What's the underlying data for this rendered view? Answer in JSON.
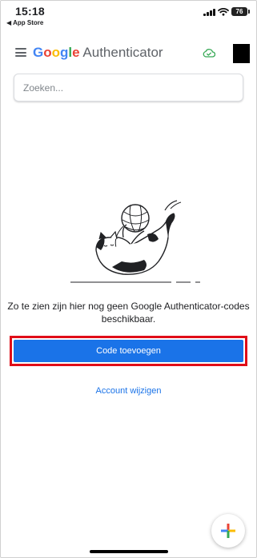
{
  "status_bar": {
    "time": "15:18",
    "back_label": "◀ App Store",
    "battery_level": "76"
  },
  "app_bar": {
    "brand_letters": [
      {
        "char": "G",
        "color": "#4285F4"
      },
      {
        "char": "o",
        "color": "#EA4335"
      },
      {
        "char": "o",
        "color": "#FBBC05"
      },
      {
        "char": "g",
        "color": "#4285F4"
      },
      {
        "char": "l",
        "color": "#34A853"
      },
      {
        "char": "e",
        "color": "#EA4335"
      }
    ],
    "product_name": " Authenticator",
    "menu_icon": "hamburger-menu-icon",
    "sync_icon": "cloud-check-icon"
  },
  "search": {
    "placeholder": "Zoeken..."
  },
  "empty_state": {
    "illustration_icon": "cat-playing-with-yarn-illustration",
    "message": "Zo te zien zijn hier nog geen Google Authenticator-codes beschikbaar."
  },
  "actions": {
    "add_code_label": "Code toevoegen",
    "switch_account_label": "Account wijzigen",
    "fab_icon": "plus-icon"
  },
  "colors": {
    "primary": "#1a73e8",
    "highlight_outline": "#e00d18",
    "sync_ok": "#34A853"
  }
}
